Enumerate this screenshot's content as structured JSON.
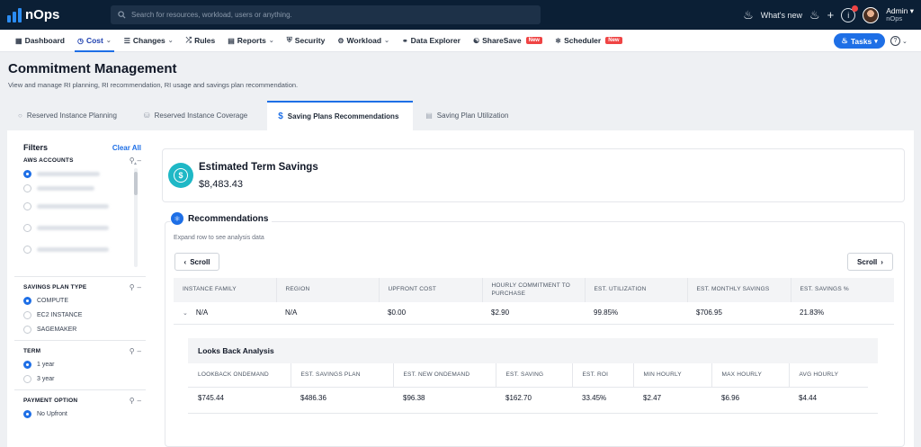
{
  "topbar": {
    "logo": "nOps",
    "search_placeholder": "Search for resources, workload, users or anything.",
    "whats_new": "What's new",
    "user_name": "Admin",
    "user_org": "nOps"
  },
  "nav": {
    "items": [
      {
        "label": "Dashboard",
        "icon": "grid-icon",
        "caret": false
      },
      {
        "label": "Cost",
        "icon": "clock-icon",
        "caret": true,
        "active": true
      },
      {
        "label": "Changes",
        "icon": "list-icon",
        "caret": true
      },
      {
        "label": "Rules",
        "icon": "shuffle-icon",
        "caret": false
      },
      {
        "label": "Reports",
        "icon": "report-icon",
        "caret": true
      },
      {
        "label": "Security",
        "icon": "shield-icon",
        "caret": false
      },
      {
        "label": "Workload",
        "icon": "gear-icon",
        "caret": true
      },
      {
        "label": "Data Explorer",
        "icon": "link-icon",
        "caret": false
      },
      {
        "label": "ShareSave",
        "icon": "share-icon",
        "caret": false,
        "badge": "New"
      },
      {
        "label": "Scheduler",
        "icon": "scheduler-icon",
        "caret": false,
        "badge": "New"
      }
    ],
    "tasks_label": "Tasks",
    "help_icon": "?"
  },
  "page": {
    "title": "Commitment Management",
    "subtitle": "View and manage RI planning, RI recommendation, RI usage and savings plan recommendation."
  },
  "tabs": [
    {
      "label": "Reserved Instance Planning",
      "active": false
    },
    {
      "label": "Reserved Instance Coverage",
      "active": false
    },
    {
      "label": "Saving Plans Recommendations",
      "active": true
    },
    {
      "label": "Saving Plan Utilization",
      "active": false
    }
  ],
  "filters": {
    "title": "Filters",
    "clear_all": "Clear All",
    "aws_accounts_title": "AWS ACCOUNTS",
    "savings_plan_type": {
      "title": "SAVINGS PLAN TYPE",
      "options": [
        {
          "label": "COMPUTE",
          "selected": true
        },
        {
          "label": "EC2 INSTANCE",
          "selected": false
        },
        {
          "label": "SAGEMAKER",
          "selected": false
        }
      ]
    },
    "term": {
      "title": "TERM",
      "options": [
        {
          "label": "1 year",
          "selected": true
        },
        {
          "label": "3 year",
          "selected": false
        }
      ]
    },
    "payment_option": {
      "title": "PAYMENT OPTION",
      "options": [
        {
          "label": "No Upfront",
          "selected": true
        }
      ]
    }
  },
  "estimated": {
    "title": "Estimated Term Savings",
    "value": "$8,483.43"
  },
  "recommendations": {
    "title": "Recommendations",
    "subtitle": "Expand row to see analysis data",
    "scroll_left": "Scroll",
    "scroll_right": "Scroll",
    "columns": [
      "INSTANCE FAMILY",
      "REGION",
      "UPFRONT COST",
      "HOURLY COMMITMENT TO PURCHASE",
      "EST. UTILIZATION",
      "EST. MONTHLY SAVINGS",
      "EST. SAVINGS %"
    ],
    "row": [
      "N/A",
      "N/A",
      "$0.00",
      "$2.90",
      "99.85%",
      "$706.95",
      "21.83%"
    ]
  },
  "lookback": {
    "title": "Looks Back Analysis",
    "columns": [
      "LOOKBACK ONDEMAND",
      "EST. SAVINGS PLAN",
      "EST. NEW ONDEMAND",
      "EST. SAVING",
      "EST. ROI",
      "MIN HOURLY",
      "MAX HOURLY",
      "AVG HOURLY"
    ],
    "row": [
      "$745.44",
      "$486.36",
      "$96.38",
      "$162.70",
      "33.45%",
      "$2.47",
      "$6.96",
      "$4.44"
    ]
  },
  "colors": {
    "topbar": "#0b1f35",
    "accent": "#1e6fe6",
    "savings_icon": "#1fb8c6",
    "badge": "#ef4444"
  }
}
